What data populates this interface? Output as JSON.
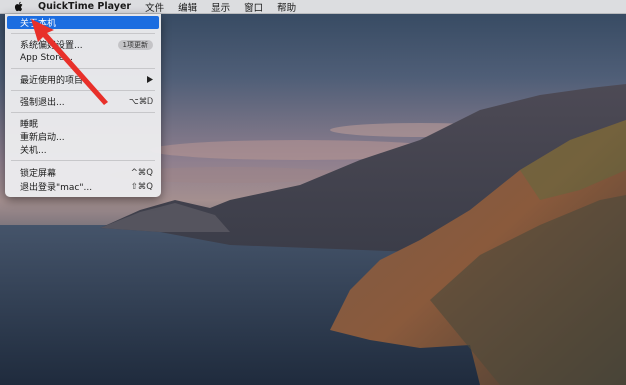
{
  "menubar": {
    "apple_icon": "apple-logo-icon",
    "app_name": "QuickTime Player",
    "items": [
      "文件",
      "编辑",
      "显示",
      "窗口",
      "帮助"
    ]
  },
  "apple_menu": {
    "about": "关于本机",
    "system_prefs": "系统偏好设置...",
    "update_badge": "1项更新",
    "app_store": "App Store...",
    "recent_items": "最近使用的项目",
    "submenu_icon": "triangle-right-icon",
    "force_quit": "强制退出...",
    "force_quit_shortcut": "⌥⌘Ꭰ",
    "sleep": "睡眠",
    "restart": "重新启动...",
    "shutdown": "关机...",
    "lock_screen": "锁定屏幕",
    "lock_screen_shortcut": "^⌘Q",
    "logout": "退出登录\"mac\"...",
    "logout_shortcut": "⇧⌘Q"
  },
  "annotation": {
    "color": "#e8302a"
  },
  "colors": {
    "highlight": "#1b6de0"
  }
}
